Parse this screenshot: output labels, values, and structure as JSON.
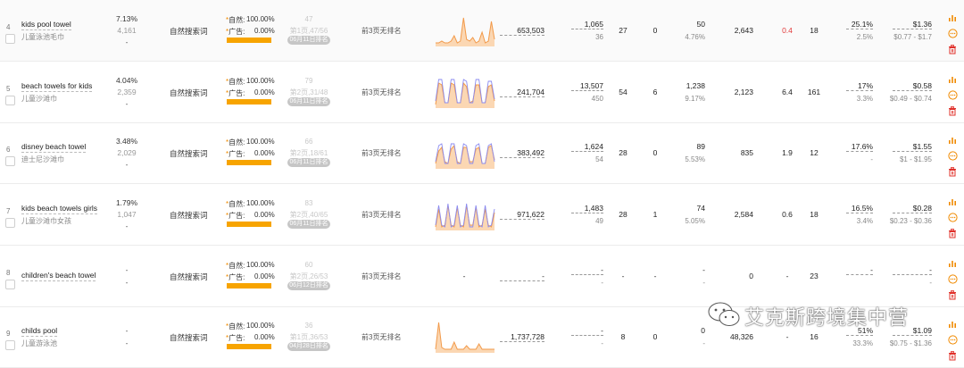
{
  "rows": [
    {
      "index": "4",
      "keyword": "kids pool towel",
      "keyword_cn": "儿童泳池毛巾",
      "share_top": "7.13%",
      "share_mid": "4,161",
      "share_bot": "-",
      "source": "自然搜索词",
      "natural_label": "自然:",
      "natural_pct": "100.00%",
      "ad_label": "广告:",
      "ad_pct": "0.00%",
      "rank_top": "47",
      "rank_detail": "第1页,47/56",
      "rank_date": "06月11日排名",
      "ad_rank": "前3页无排名",
      "search_volume": "653,503",
      "v1_top": "1,065",
      "v1_bot": "36",
      "v2": "27",
      "v3": "0",
      "v4_top": "50",
      "v4_bot": "4.76%",
      "v5": "2,643",
      "v6": "0.4",
      "v7": "18",
      "v8_top": "25.1%",
      "v8_bot": "2.5%",
      "price_top": "$1.36",
      "price_bot": "$0.77 - $1.7"
    },
    {
      "index": "5",
      "keyword": "beach towels for kids",
      "keyword_cn": "儿童沙滩巾",
      "share_top": "4.04%",
      "share_mid": "2,359",
      "share_bot": "-",
      "source": "自然搜索词",
      "natural_label": "自然:",
      "natural_pct": "100.00%",
      "ad_label": "广告:",
      "ad_pct": "0.00%",
      "rank_top": "79",
      "rank_detail": "第2页,31/48",
      "rank_date": "06月11日排名",
      "ad_rank": "前3页无排名",
      "search_volume": "241,704",
      "v1_top": "13,507",
      "v1_bot": "450",
      "v2": "54",
      "v3": "6",
      "v4_top": "1,238",
      "v4_bot": "9.17%",
      "v5": "2,123",
      "v6": "6.4",
      "v7": "161",
      "v8_top": "17%",
      "v8_bot": "3.3%",
      "price_top": "$0.58",
      "price_bot": "$0.49 - $0.74"
    },
    {
      "index": "6",
      "keyword": "disney beach towel",
      "keyword_cn": "迪士尼沙滩巾",
      "share_top": "3.48%",
      "share_mid": "2,029",
      "share_bot": "-",
      "source": "自然搜索词",
      "natural_label": "自然:",
      "natural_pct": "100.00%",
      "ad_label": "广告:",
      "ad_pct": "0.00%",
      "rank_top": "66",
      "rank_detail": "第2页,18/61",
      "rank_date": "06月11日排名",
      "ad_rank": "前3页无排名",
      "search_volume": "383,492",
      "v1_top": "1,624",
      "v1_bot": "54",
      "v2": "28",
      "v3": "0",
      "v4_top": "89",
      "v4_bot": "5.53%",
      "v5": "835",
      "v6": "1.9",
      "v7": "12",
      "v8_top": "17.6%",
      "v8_bot": "-",
      "price_top": "$1.55",
      "price_bot": "$1 - $1.95"
    },
    {
      "index": "7",
      "keyword": "kids beach towels girls",
      "keyword_cn": "儿童沙滩巾女孩",
      "share_top": "1.79%",
      "share_mid": "1,047",
      "share_bot": "-",
      "source": "自然搜索词",
      "natural_label": "自然:",
      "natural_pct": "100.00%",
      "ad_label": "广告:",
      "ad_pct": "0.00%",
      "rank_top": "83",
      "rank_detail": "第2页,40/65",
      "rank_date": "06月11日排名",
      "ad_rank": "前3页无排名",
      "search_volume": "971,622",
      "v1_top": "1,483",
      "v1_bot": "49",
      "v2": "28",
      "v3": "1",
      "v4_top": "74",
      "v4_bot": "5.05%",
      "v5": "2,584",
      "v6": "0.6",
      "v7": "18",
      "v8_top": "16.5%",
      "v8_bot": "3.4%",
      "price_top": "$0.28",
      "price_bot": "$0.23 - $0.36"
    },
    {
      "index": "8",
      "keyword": "children's beach towel",
      "keyword_cn": "",
      "share_top": "-",
      "share_mid": "-",
      "share_bot": "",
      "source": "自然搜索词",
      "natural_label": "自然:",
      "natural_pct": "100.00%",
      "ad_label": "广告:",
      "ad_pct": "0.00%",
      "rank_top": "60",
      "rank_detail": "第2页,26/53",
      "rank_date": "06月12日排名",
      "ad_rank": "前3页无排名",
      "search_volume": "-",
      "v1_top": "-",
      "v1_bot": "-",
      "v2": "-",
      "v3": "-",
      "v4_top": "-",
      "v4_bot": "-",
      "v5": "0",
      "v6": "-",
      "v7": "23",
      "v8_top": "-",
      "v8_bot": "",
      "price_top": "-",
      "price_bot": "-"
    },
    {
      "index": "9",
      "keyword": "childs pool",
      "keyword_cn": "儿童游泳池",
      "share_top": "-",
      "share_mid": "-",
      "share_bot": "",
      "source": "自然搜索词",
      "natural_label": "自然:",
      "natural_pct": "100.00%",
      "ad_label": "广告:",
      "ad_pct": "0.00%",
      "rank_top": "36",
      "rank_detail": "第1页,36/53",
      "rank_date": "04月28日排名",
      "ad_rank": "前3页无排名",
      "search_volume": "1,737,728",
      "v1_top": "-",
      "v1_bot": "-",
      "v2": "8",
      "v3": "0",
      "v4_top": "0",
      "v4_bot": "-",
      "v5": "48,326",
      "v6": "-",
      "v7": "16",
      "v8_top": "51%",
      "v8_bot": "33.3%",
      "price_top": "$1.09",
      "price_bot": "$0.75 - $1.36"
    }
  ],
  "empty_trend": "-",
  "icons": [
    "bar-chart-icon",
    "more-icon",
    "delete-icon"
  ],
  "colors": {
    "accent": "#f08a00",
    "bar": "#f7a400",
    "trend_fill": "#fbd7b3",
    "trend_line": "#f29a4a",
    "trend_alt": "#8b8bf0",
    "delete": "#e0302a"
  },
  "watermark": "艾克斯跨境集中营"
}
